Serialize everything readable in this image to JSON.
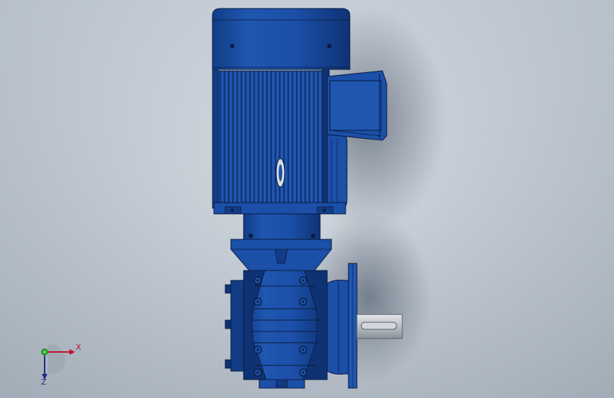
{
  "viewport": {
    "background_colors": [
      "#d6dde4",
      "#a9b4c0"
    ]
  },
  "model": {
    "description_icon": "gear-motor-model-icon",
    "colors": {
      "body": "#1b4fa8",
      "body_dark": "#0f3274",
      "body_light": "#2e66c4",
      "outline": "#0a1a3a",
      "shaft": "#c8ccd2",
      "shadow": "#6e7a88"
    }
  },
  "triad": {
    "x_label": "X",
    "z_label": "Z",
    "colors": {
      "x": "#c0102a",
      "y": "#2a9a2a",
      "z": "#1b2a8a"
    }
  }
}
